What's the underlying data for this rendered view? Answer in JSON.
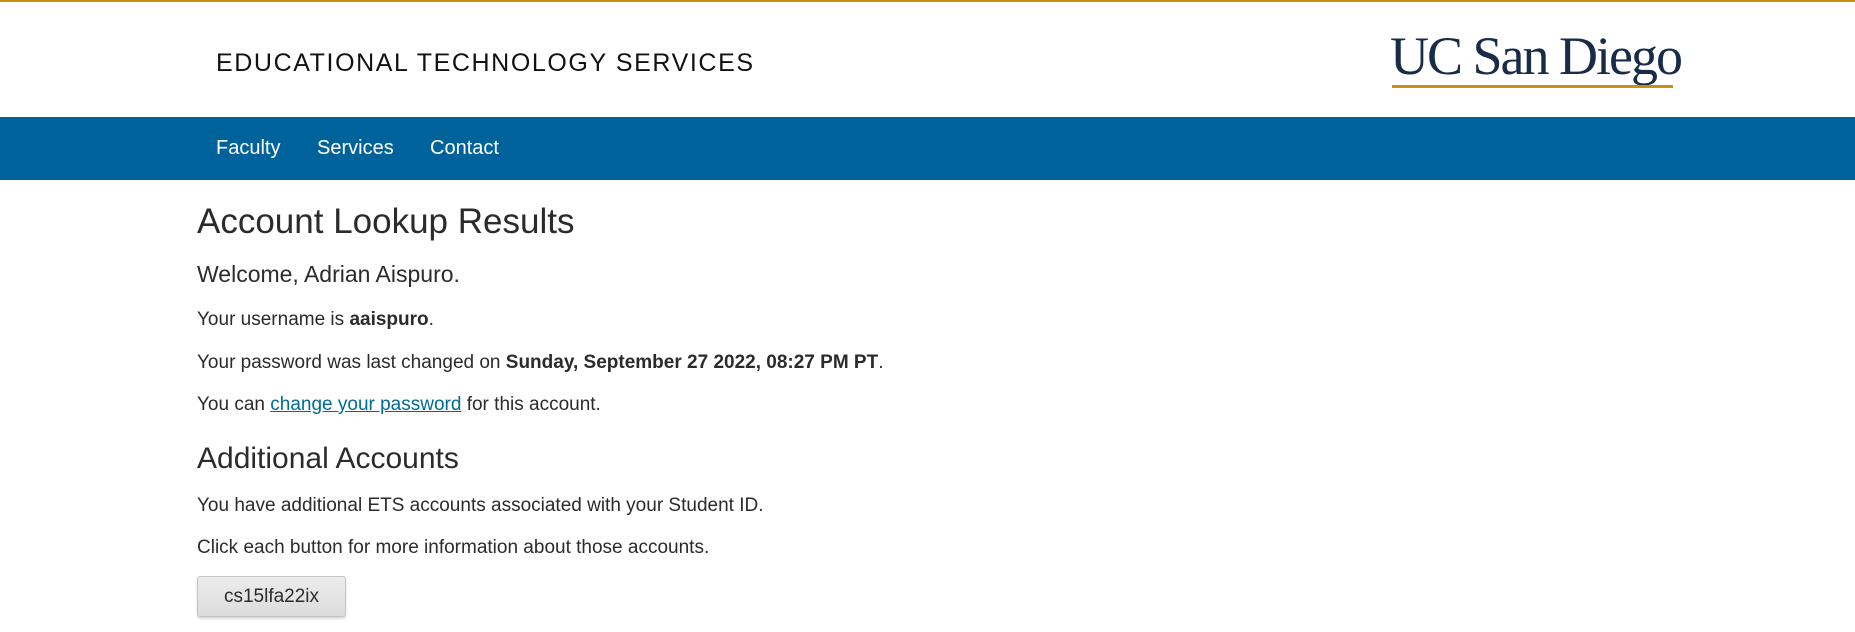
{
  "header": {
    "site_title": "EDUCATIONAL TECHNOLOGY SERVICES",
    "logo_text": "UC San Diego"
  },
  "nav": {
    "items": [
      {
        "label": "Faculty"
      },
      {
        "label": "Services"
      },
      {
        "label": "Contact"
      }
    ]
  },
  "main": {
    "title": "Account Lookup Results",
    "welcome": "Welcome, Adrian Aispuro.",
    "username_prefix": "Your username is ",
    "username": "aaispuro",
    "username_suffix": ".",
    "password_prefix": "Your password was last changed on ",
    "password_date": "Sunday, September 27 2022, 08:27 PM PT",
    "password_suffix": ".",
    "change_prefix": "You can ",
    "change_link": "change your password",
    "change_suffix": " for this account.",
    "additional_title": "Additional Accounts",
    "additional_text": "You have additional ETS accounts associated with your Student ID.",
    "click_text": "Click each button for more information about those accounts.",
    "accounts": [
      {
        "label": "cs15lfa22ix"
      }
    ]
  },
  "colors": {
    "gold": "#c69214",
    "navy": "#182b49",
    "nav_blue": "#00629b",
    "link_blue": "#006a96"
  }
}
